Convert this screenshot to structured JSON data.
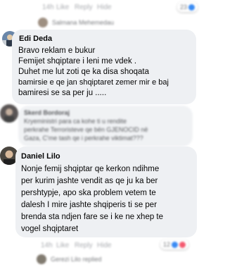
{
  "top_actions": {
    "time": "14h",
    "like": "Like",
    "reply": "Reply",
    "hide": "Hide",
    "reaction_count": "23"
  },
  "reply_preview_top": {
    "name": "Salmana Mehemedau"
  },
  "comment1": {
    "author": "Edi Deda",
    "lines": [
      "Bravo reklam e bukur",
      "Femijet shqiptare i leni me vdek .",
      "Duhet me lut zoti qe ka disa shoqata",
      "bamirsie e qe jan shqiptaret zemer mir e baj",
      "bamiresi se sa per ju ....."
    ]
  },
  "comment2": {
    "author": "Skerd Bordoraj",
    "lines": [
      "Kryeministri para ca kohe  ti u rendite",
      "perkrahe Terroristeve qe bën GJENOCID në",
      "Gaza, C'me tash qe i perkrahe viktimat???"
    ]
  },
  "comment3": {
    "author": "Daniel Lilo",
    "lines": [
      "Nonje femij shqiptar qe kerkon ndihme",
      "per kurim jashte vendit as qe ju ka ber",
      "pershtypje, apo ska problem vetem te",
      "dalesh I mire jashte shqiperis ti se per",
      "brenda sta ndjen fare se i ke ne xhep te",
      "vogel shqiptaret"
    ]
  },
  "bottom_actions": {
    "time": "14h",
    "like": "Like",
    "reply": "Reply",
    "hide": "Hide",
    "reaction_count": "12"
  },
  "reply_preview_bottom": {
    "name": "Gerezi Lilo replied"
  },
  "colors": {
    "bubble": "#eef0f3",
    "meta": "#9a9da2",
    "like_blue": "#1877f2",
    "love_red": "#f33e58"
  }
}
